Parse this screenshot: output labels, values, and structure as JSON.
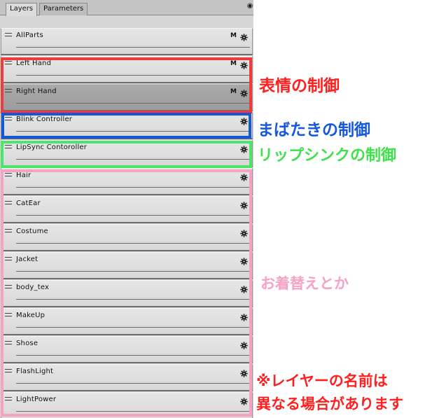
{
  "tabs": [
    {
      "label": "Layers",
      "active": true
    },
    {
      "label": "Parameters",
      "active": false
    }
  ],
  "tab_menu_icon": "panel-menu-icon",
  "layers": [
    {
      "name": "AllParts",
      "mask": "M",
      "selected": false
    },
    {
      "name": "Left Hand",
      "mask": "M",
      "selected": false
    },
    {
      "name": "Right Hand",
      "mask": "M",
      "selected": true
    },
    {
      "name": "Blink Controller",
      "mask": "",
      "selected": false
    },
    {
      "name": "LipSync Contoroller",
      "mask": "",
      "selected": false
    },
    {
      "name": "Hair",
      "mask": "",
      "selected": false
    },
    {
      "name": "CatEar",
      "mask": "",
      "selected": false
    },
    {
      "name": "Costume",
      "mask": "",
      "selected": false
    },
    {
      "name": "Jacket",
      "mask": "",
      "selected": false
    },
    {
      "name": "body_tex",
      "mask": "",
      "selected": false
    },
    {
      "name": "MakeUp",
      "mask": "",
      "selected": false
    },
    {
      "name": "Shose",
      "mask": "",
      "selected": false
    },
    {
      "name": "FlashLight",
      "mask": "",
      "selected": false
    },
    {
      "name": "LightPower",
      "mask": "",
      "selected": false
    }
  ],
  "layer_icons": {
    "handle": "drag-handle-icon",
    "settings": "gear-icon"
  },
  "annotations": {
    "expression": "表情の制御",
    "blink": "まばたきの制御",
    "lipsync": "リップシンクの制御",
    "outfit": "お着替えとか",
    "note_line1": "※レイヤーの名前は",
    "note_line2": "異なる場合があります"
  },
  "colors": {
    "red": "#f23a3a",
    "blue": "#1557d6",
    "green": "#4ce56a",
    "pink": "#f6a2c4"
  }
}
